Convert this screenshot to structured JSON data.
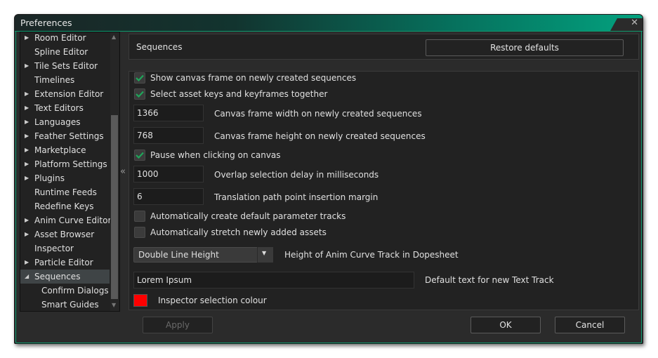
{
  "window": {
    "title": "Preferences"
  },
  "sidebar": {
    "items": [
      {
        "label": "Room Editor",
        "expandable": true
      },
      {
        "label": "Spline Editor",
        "expandable": false
      },
      {
        "label": "Tile Sets Editor",
        "expandable": true
      },
      {
        "label": "Timelines",
        "expandable": false
      },
      {
        "label": "Extension Editor",
        "expandable": true
      },
      {
        "label": "Text Editors",
        "expandable": true
      },
      {
        "label": "Languages",
        "expandable": true
      },
      {
        "label": "Feather Settings",
        "expandable": true
      },
      {
        "label": "Marketplace",
        "expandable": true
      },
      {
        "label": "Platform Settings",
        "expandable": true
      },
      {
        "label": "Plugins",
        "expandable": true
      },
      {
        "label": "Runtime Feeds",
        "expandable": false
      },
      {
        "label": "Redefine Keys",
        "expandable": false
      },
      {
        "label": "Anim Curve Editor",
        "expandable": true
      },
      {
        "label": "Asset Browser",
        "expandable": true
      },
      {
        "label": "Inspector",
        "expandable": false
      },
      {
        "label": "Particle Editor",
        "expandable": true
      },
      {
        "label": "Sequences",
        "expandable": true,
        "expanded": true,
        "selected": true
      },
      {
        "label": "Confirm Dialogs",
        "child": true
      },
      {
        "label": "Smart Guides",
        "child": true
      }
    ]
  },
  "header": {
    "title": "Sequences",
    "restore_label": "Restore defaults"
  },
  "settings": {
    "show_canvas_frame": {
      "label": "Show canvas frame on newly created sequences",
      "checked": true
    },
    "select_keys_together": {
      "label": "Select asset keys and keyframes together",
      "checked": true
    },
    "frame_width": {
      "value": "1366",
      "label": "Canvas frame width on newly created sequences"
    },
    "frame_height": {
      "value": "768",
      "label": "Canvas frame height on newly created sequences"
    },
    "pause_on_click": {
      "label": "Pause when clicking on canvas",
      "checked": true
    },
    "overlap_delay": {
      "value": "1000",
      "label": "Overlap selection delay in milliseconds"
    },
    "path_margin": {
      "value": "6",
      "label": "Translation path point insertion margin"
    },
    "auto_param_tracks": {
      "label": "Automatically create default parameter tracks",
      "checked": false
    },
    "auto_stretch": {
      "label": "Automatically stretch newly added assets",
      "checked": false
    },
    "curve_height": {
      "value": "Double Line Height",
      "label": "Height of Anim Curve Track in Dopesheet"
    },
    "default_text": {
      "value": "Lorem Ipsum",
      "label": "Default text for new Text Track"
    },
    "selection_colour": {
      "label": "Inspector selection colour",
      "color": "#ff0000"
    }
  },
  "footer": {
    "apply": "Apply",
    "ok": "OK",
    "cancel": "Cancel"
  },
  "colors": {
    "accent": "#03a27f",
    "check": "#1fa65a"
  }
}
